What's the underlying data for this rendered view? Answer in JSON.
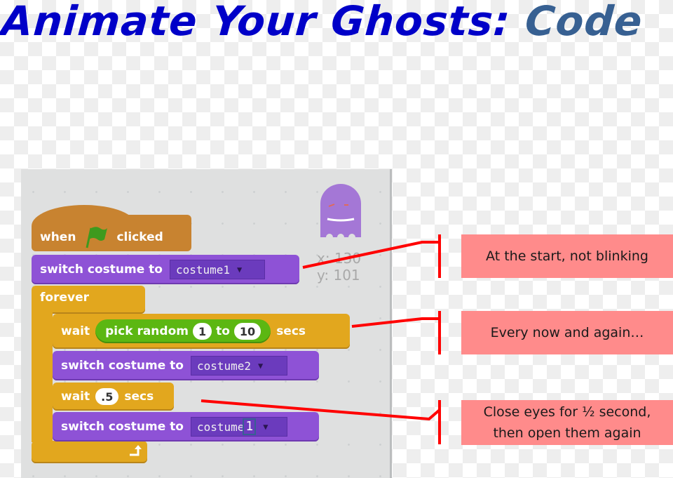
{
  "title": {
    "main": "Animate Your Ghosts: ",
    "accent": "Code"
  },
  "colors": {
    "title": "#0000c8",
    "title_accent": "#376092",
    "events": "#c88330",
    "looks": "#8e52d6",
    "control": "#e2a71e",
    "operators": "#5cb712",
    "note_bg": "#ff8b8b",
    "connector": "#ff0000"
  },
  "sprite": {
    "icon": "ghost-sprite-icon",
    "x_label": "x:",
    "x_value": "130",
    "y_label": "y:",
    "y_value": "101"
  },
  "script": {
    "hat": {
      "before": "when",
      "icon": "green-flag-icon",
      "after": "clicked"
    },
    "switch1": {
      "label": "switch costume to",
      "value": "costume1"
    },
    "forever": {
      "label": "forever"
    },
    "wait1": {
      "label": "wait",
      "reporter": "pick random",
      "from": "1",
      "to_label": "to",
      "to": "10",
      "unit": "secs"
    },
    "switch2": {
      "label": "switch costume to",
      "value": "costume2"
    },
    "wait2": {
      "label": "wait",
      "value": ".5",
      "unit": "secs"
    },
    "switch3": {
      "label": "switch costume to",
      "value": "costume",
      "highlight": "1"
    }
  },
  "notes": [
    {
      "text": "At the start, not blinking"
    },
    {
      "text": "Every now and again…"
    },
    {
      "line1": "Close eyes for ½ second,",
      "line2": "then open them again"
    }
  ]
}
